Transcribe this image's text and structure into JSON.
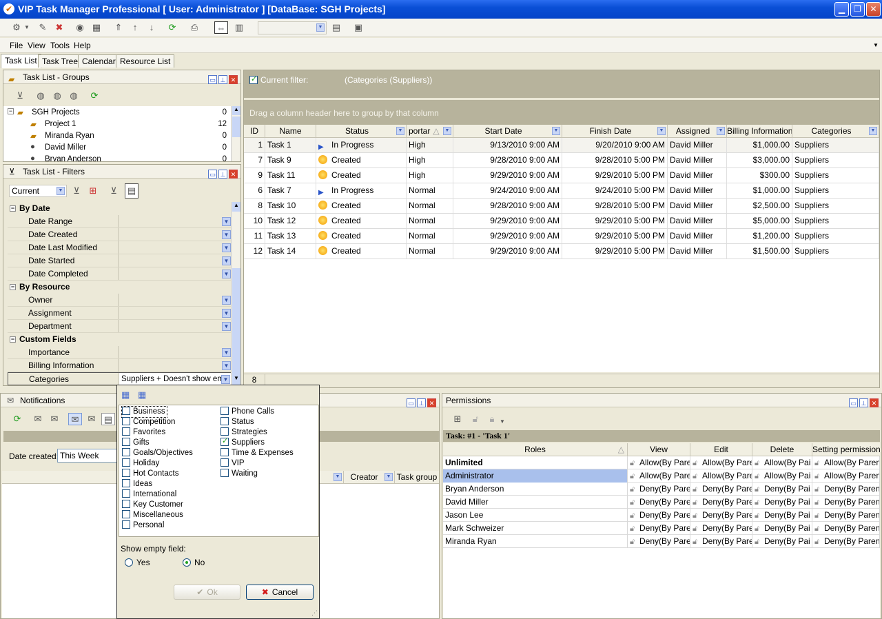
{
  "window": {
    "title": "VIP Task Manager Professional [ User: Administrator ] [DataBase: SGH Projects]"
  },
  "menubar": {
    "file": "File",
    "view": "View",
    "tools": "Tools",
    "help": "Help"
  },
  "tabs": [
    "Task List",
    "Task Tree",
    "Calendar",
    "Resource List"
  ],
  "groups_panel": {
    "title": "Task List - Groups",
    "items": [
      {
        "name": "SGH Projects",
        "count": "0"
      },
      {
        "name": "Project 1",
        "count": "12"
      },
      {
        "name": "Miranda Ryan",
        "count": "0"
      },
      {
        "name": "David Miller",
        "count": "0"
      },
      {
        "name": "Bryan Anderson",
        "count": "0"
      }
    ]
  },
  "filters_panel": {
    "title": "Task List - Filters",
    "current": "Current",
    "sections": [
      {
        "title": "By Date",
        "rows": [
          "Date Range",
          "Date Created",
          "Date Last Modified",
          "Date Started",
          "Date Completed"
        ]
      },
      {
        "title": "By Resource",
        "rows": [
          "Owner",
          "Assignment",
          "Department"
        ]
      },
      {
        "title": "Custom Fields",
        "rows": [
          "Importance",
          "Billing Information",
          "Categories"
        ]
      }
    ],
    "categories_value": "Suppliers + Doesn't show emp"
  },
  "task_grid": {
    "filter_label": "Current filter:",
    "filter_value": "(Categories  (Suppliers))",
    "group_hint": "Drag a column header here to group by that column",
    "columns": [
      "ID",
      "Name",
      "Status",
      "portar",
      "Start Date",
      "Finish Date",
      "Assigned",
      "Billing Information",
      "Categories"
    ],
    "rows": [
      {
        "id": "1",
        "name": "Task 1",
        "status": "In Progress",
        "importance": "High",
        "start": "9/13/2010 9:00 AM",
        "finish": "9/20/2010 9:00 AM",
        "assigned": "David Miller",
        "billing": "$1,000.00",
        "category": "Suppliers"
      },
      {
        "id": "7",
        "name": "Task 9",
        "status": "Created",
        "importance": "High",
        "start": "9/28/2010 9:00 AM",
        "finish": "9/28/2010 5:00 PM",
        "assigned": "David Miller",
        "billing": "$3,000.00",
        "category": "Suppliers"
      },
      {
        "id": "9",
        "name": "Task 11",
        "status": "Created",
        "importance": "High",
        "start": "9/29/2010 9:00 AM",
        "finish": "9/29/2010 5:00 PM",
        "assigned": "David Miller",
        "billing": "$300.00",
        "category": "Suppliers"
      },
      {
        "id": "6",
        "name": "Task 7",
        "status": "In Progress",
        "importance": "Normal",
        "start": "9/24/2010 9:00 AM",
        "finish": "9/24/2010 5:00 PM",
        "assigned": "David Miller",
        "billing": "$1,000.00",
        "category": "Suppliers"
      },
      {
        "id": "8",
        "name": "Task 10",
        "status": "Created",
        "importance": "Normal",
        "start": "9/28/2010 9:00 AM",
        "finish": "9/28/2010 5:00 PM",
        "assigned": "David Miller",
        "billing": "$2,500.00",
        "category": "Suppliers"
      },
      {
        "id": "10",
        "name": "Task 12",
        "status": "Created",
        "importance": "Normal",
        "start": "9/29/2010 9:00 AM",
        "finish": "9/29/2010 5:00 PM",
        "assigned": "David Miller",
        "billing": "$5,000.00",
        "category": "Suppliers"
      },
      {
        "id": "11",
        "name": "Task 13",
        "status": "Created",
        "importance": "Normal",
        "start": "9/29/2010 9:00 AM",
        "finish": "9/29/2010 5:00 PM",
        "assigned": "David Miller",
        "billing": "$1,200.00",
        "category": "Suppliers"
      },
      {
        "id": "12",
        "name": "Task 14",
        "status": "Created",
        "importance": "Normal",
        "start": "9/29/2010 9:00 AM",
        "finish": "9/29/2010 5:00 PM",
        "assigned": "David Miller",
        "billing": "$1,500.00",
        "category": "Suppliers"
      }
    ],
    "footer_count": "8"
  },
  "notifications": {
    "title": "Notifications",
    "date_created_label": "Date created:",
    "date_created_value": "This Week",
    "col_creator": "Creator",
    "col_task_group": "Task group"
  },
  "category_popup": {
    "col1": [
      {
        "label": "Business",
        "checked": false
      },
      {
        "label": "Competition",
        "checked": false
      },
      {
        "label": "Favorites",
        "checked": false
      },
      {
        "label": "Gifts",
        "checked": false
      },
      {
        "label": "Goals/Objectives",
        "checked": false
      },
      {
        "label": "Holiday",
        "checked": false
      },
      {
        "label": "Hot Contacts",
        "checked": false
      },
      {
        "label": "Ideas",
        "checked": false
      },
      {
        "label": "International",
        "checked": false
      },
      {
        "label": "Key Customer",
        "checked": false
      },
      {
        "label": "Miscellaneous",
        "checked": false
      },
      {
        "label": "Personal",
        "checked": false
      }
    ],
    "col2": [
      {
        "label": "Phone Calls",
        "checked": false
      },
      {
        "label": "Status",
        "checked": false
      },
      {
        "label": "Strategies",
        "checked": false
      },
      {
        "label": "Suppliers",
        "checked": true
      },
      {
        "label": "Time & Expenses",
        "checked": false
      },
      {
        "label": "VIP",
        "checked": false
      },
      {
        "label": "Waiting",
        "checked": false
      }
    ],
    "show_empty_label": "Show empty field:",
    "yes": "Yes",
    "no": "No",
    "ok": "Ok",
    "cancel": "Cancel"
  },
  "permissions": {
    "title": "Permissions",
    "task_label": "Task: #1 - 'Task 1'",
    "columns": [
      "Roles",
      "View",
      "Edit",
      "Delete",
      "Setting permissions"
    ],
    "rows": [
      {
        "role": "Unlimited",
        "view": "Allow(By Pare",
        "edit": "Allow(By Pare",
        "delete": "Allow(By Pai",
        "setting": "Allow(By Paren"
      },
      {
        "role": "Administrator",
        "view": "Allow(By Pare",
        "edit": "Allow(By Pare",
        "delete": "Allow(By Pai",
        "setting": "Allow(By Paren"
      },
      {
        "role": "Bryan Anderson",
        "view": "Deny(By Pare",
        "edit": "Deny(By Pare",
        "delete": "Deny(By Pai",
        "setting": "Deny(By Paren"
      },
      {
        "role": "David Miller",
        "view": "Deny(By Pare",
        "edit": "Deny(By Pare",
        "delete": "Deny(By Pai",
        "setting": "Deny(By Paren"
      },
      {
        "role": "Jason Lee",
        "view": "Deny(By Pare",
        "edit": "Deny(By Pare",
        "delete": "Deny(By Pai",
        "setting": "Deny(By Paren"
      },
      {
        "role": "Mark Schweizer",
        "view": "Deny(By Pare",
        "edit": "Deny(By Pare",
        "delete": "Deny(By Pai",
        "setting": "Deny(By Paren"
      },
      {
        "role": "Miranda Ryan",
        "view": "Deny(By Pare",
        "edit": "Deny(By Pare",
        "delete": "Deny(By Pai",
        "setting": "Deny(By Paren"
      }
    ]
  },
  "colors": {
    "title_blue": "#0a4fd6",
    "selected_row": "#a9c0ec",
    "accent_green": "#21a121"
  }
}
